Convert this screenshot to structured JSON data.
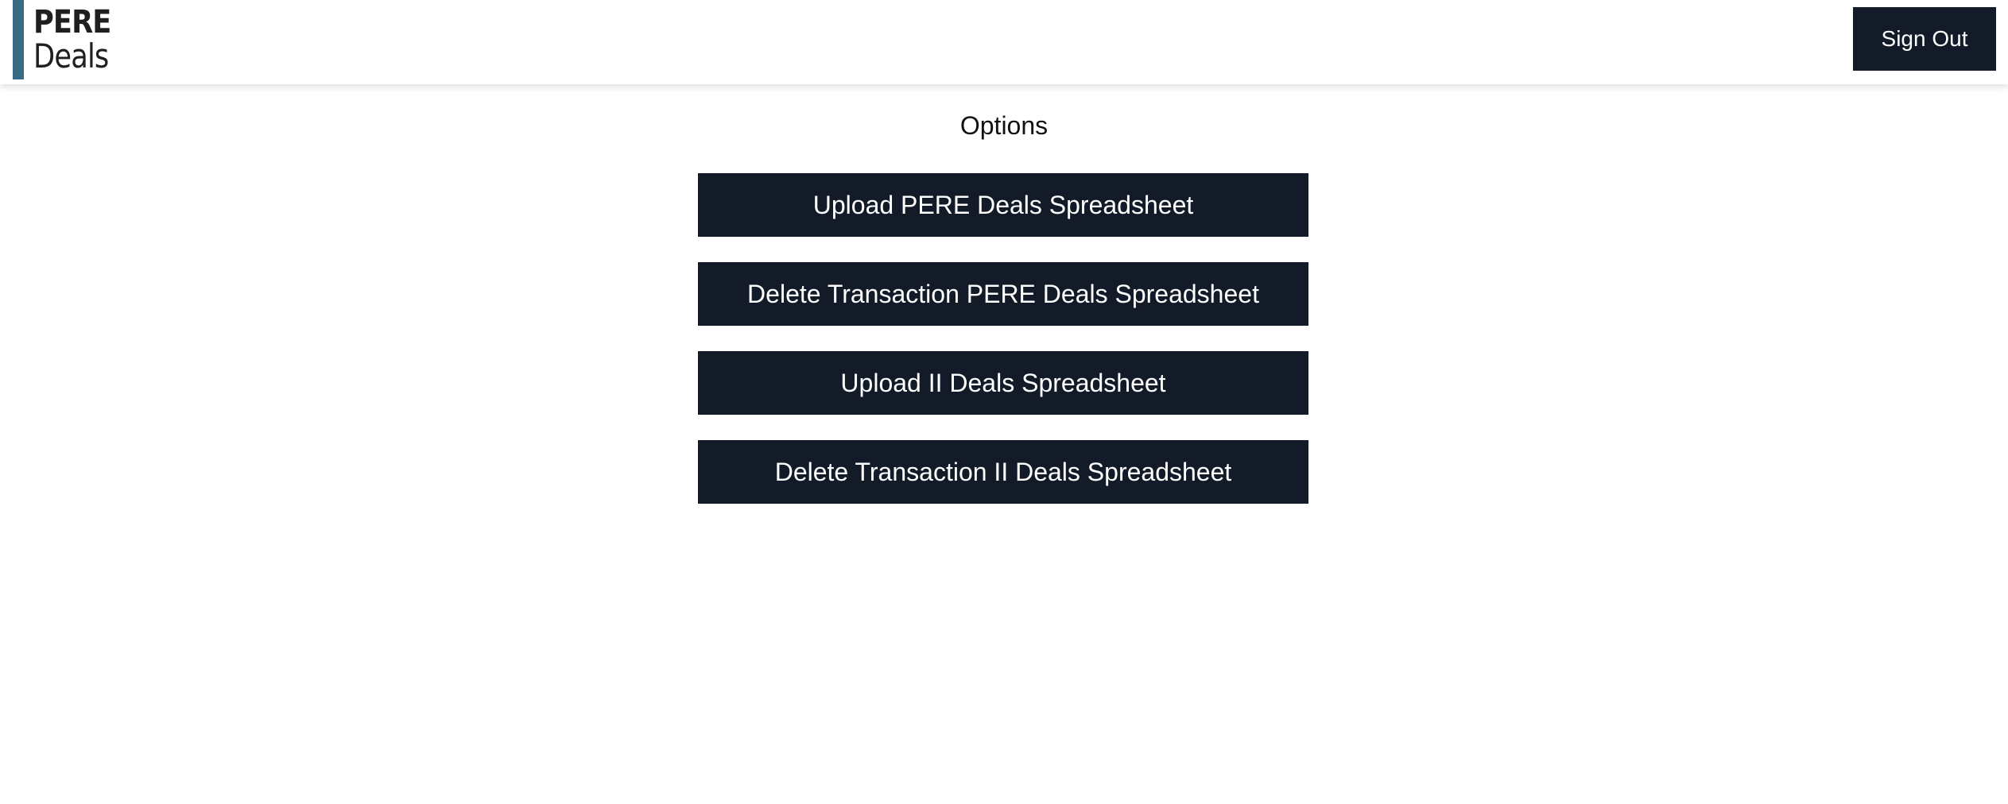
{
  "header": {
    "logo": {
      "line1": "PERE",
      "line2": "Deals",
      "accent_color": "#3a6b85"
    },
    "sign_out_label": "Sign Out"
  },
  "main": {
    "title": "Options",
    "buttons": [
      {
        "label": "Upload PERE Deals Spreadsheet"
      },
      {
        "label": "Delete Transaction PERE Deals Spreadsheet"
      },
      {
        "label": "Upload II Deals Spreadsheet"
      },
      {
        "label": "Delete Transaction II Deals Spreadsheet"
      }
    ]
  },
  "colors": {
    "button_bg": "#131a28",
    "button_text": "#ffffff",
    "page_bg": "#ffffff"
  }
}
